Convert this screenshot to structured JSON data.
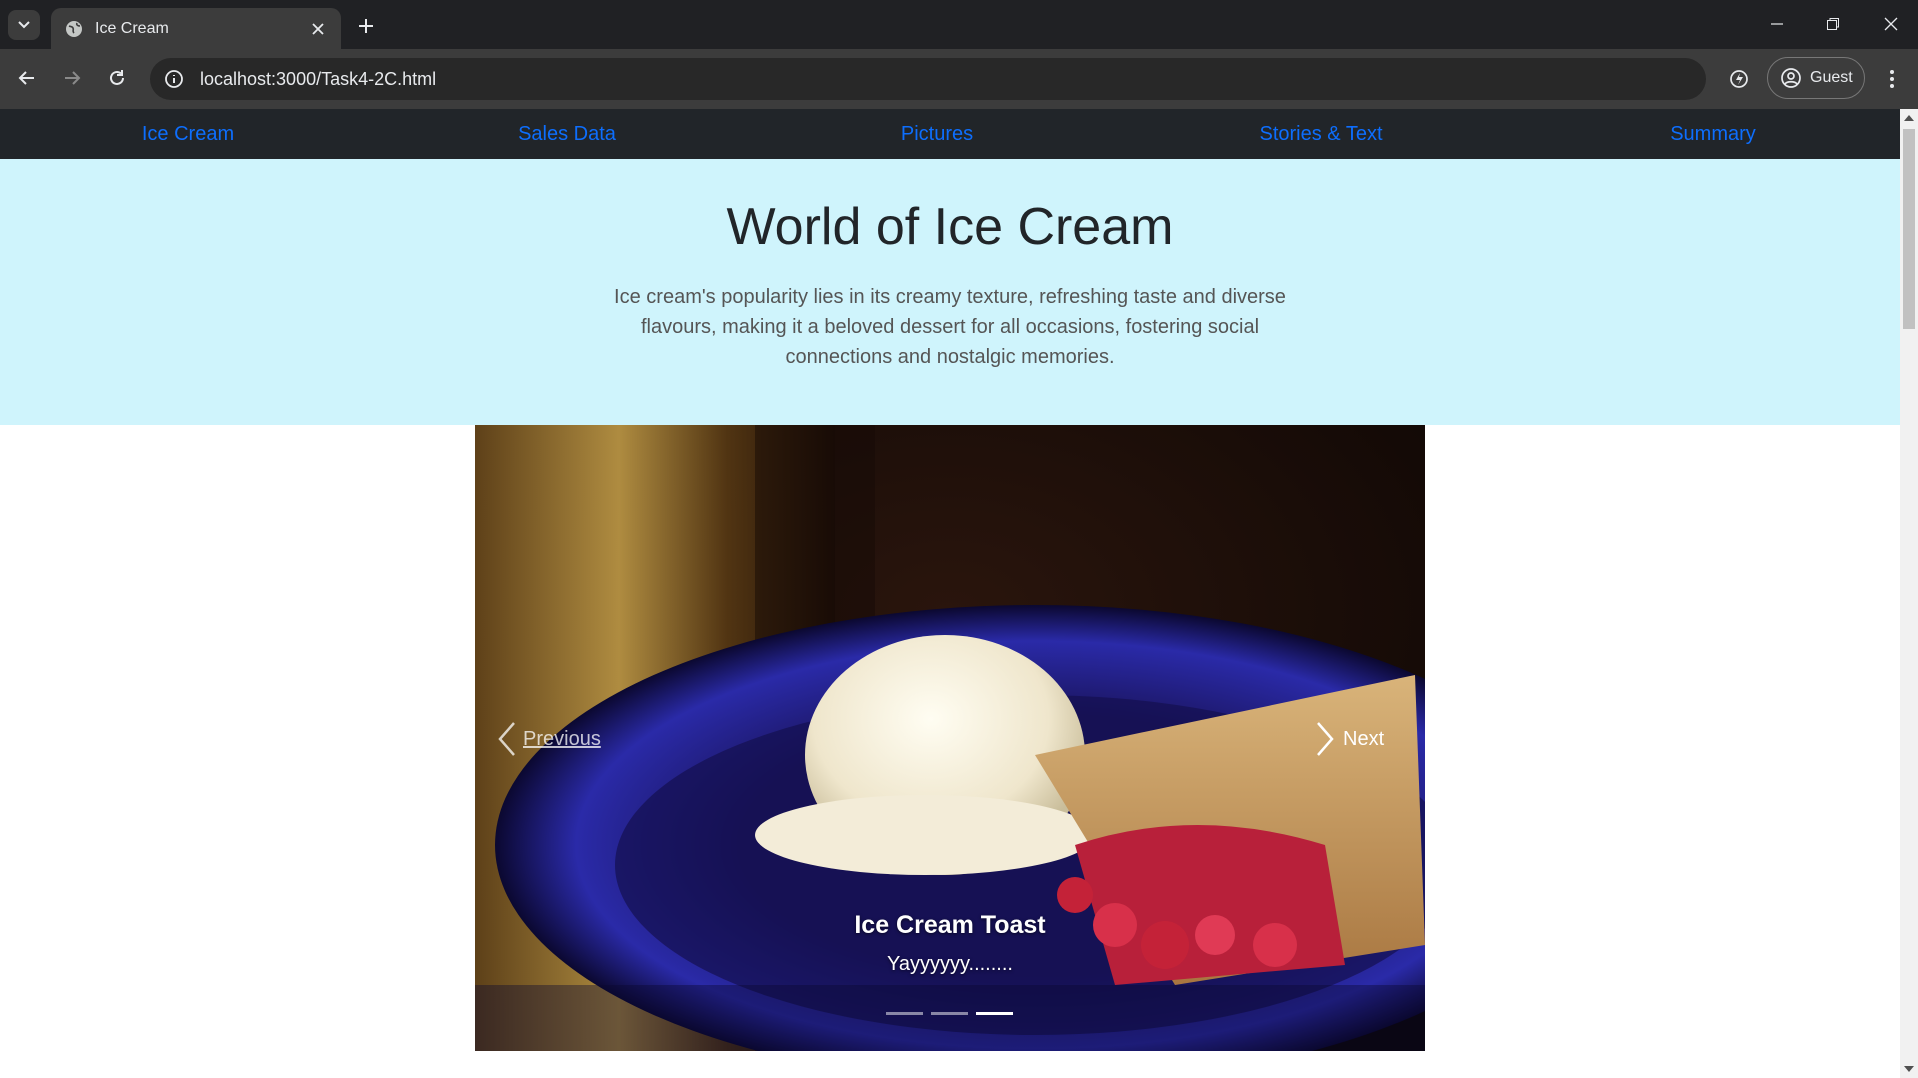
{
  "browser": {
    "tab_title": "Ice Cream",
    "url": "localhost:3000/Task4-2C.html",
    "profile_label": "Guest"
  },
  "nav": {
    "items": [
      {
        "label": "Ice Cream"
      },
      {
        "label": "Sales Data"
      },
      {
        "label": "Pictures"
      },
      {
        "label": "Stories & Text"
      },
      {
        "label": "Summary"
      }
    ]
  },
  "hero": {
    "title": "World of Ice Cream",
    "description": "Ice cream's popularity lies in its creamy texture, refreshing taste and diverse flavours, making it a beloved dessert for all occasions, fostering social connections and nostalgic memories."
  },
  "carousel": {
    "prev_label": "Previous",
    "next_label": "Next",
    "caption_title": "Ice Cream Toast",
    "caption_text": "Yayyyyyy........",
    "slide_count": 3,
    "active_slide": 3
  },
  "colors": {
    "nav_bg": "#212529",
    "nav_link": "#0d6efd",
    "hero_bg": "#cff4fc"
  }
}
